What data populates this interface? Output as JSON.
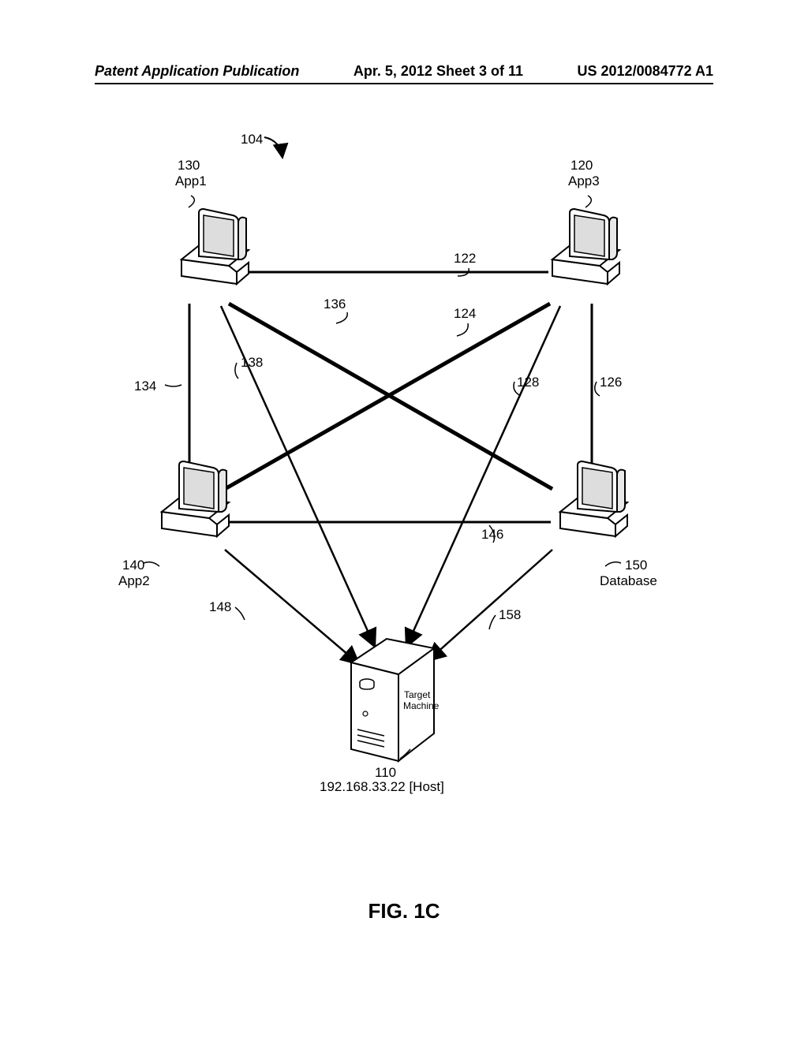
{
  "header": {
    "left": "Patent Application Publication",
    "center": "Apr. 5, 2012  Sheet 3 of 11",
    "right": "US 2012/0084772 A1"
  },
  "figure_label": "FIG. 1C",
  "refs": {
    "ref104": "104",
    "ref130_num": "130",
    "ref130_name": "App1",
    "ref120_num": "120",
    "ref120_name": "App3",
    "ref122": "122",
    "ref136": "136",
    "ref124": "124",
    "ref134": "134",
    "ref138": "138",
    "ref128": "128",
    "ref126": "126",
    "ref146": "146",
    "ref140_num": "140",
    "ref140_name": "App2",
    "ref150_num": "150",
    "ref150_name": "Database",
    "ref148": "148",
    "ref158": "158",
    "ref110": "110",
    "target_label": "Target\nMachine",
    "host_label": "192.168.33.22 [Host]"
  }
}
